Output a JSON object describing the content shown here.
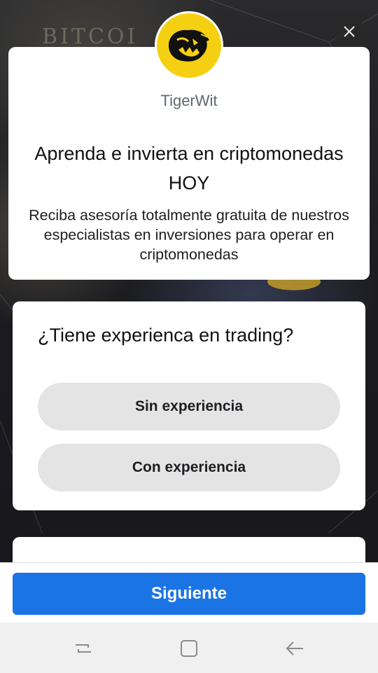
{
  "app": {
    "brand_name": "TigerWit",
    "brand_color": "#f5d012",
    "accent_color": "#1b74e4"
  },
  "header": {
    "headline": "Aprenda e invierta en criptomonedas HOY",
    "subline": "Reciba asesoría totalmente gratuita de nuestros especialistas en inversiones para operar en criptomonedas"
  },
  "question": {
    "title": "¿Tiene experienca en trading?",
    "options": [
      {
        "label": "Sin experiencia"
      },
      {
        "label": "Con experiencia"
      }
    ]
  },
  "footer": {
    "next_label": "Siguiente"
  },
  "icons": {
    "close": "close-icon",
    "logo": "tiger-logo-icon",
    "nav_recent": "recent-apps-icon",
    "nav_home": "home-icon",
    "nav_back": "back-arrow-icon"
  }
}
